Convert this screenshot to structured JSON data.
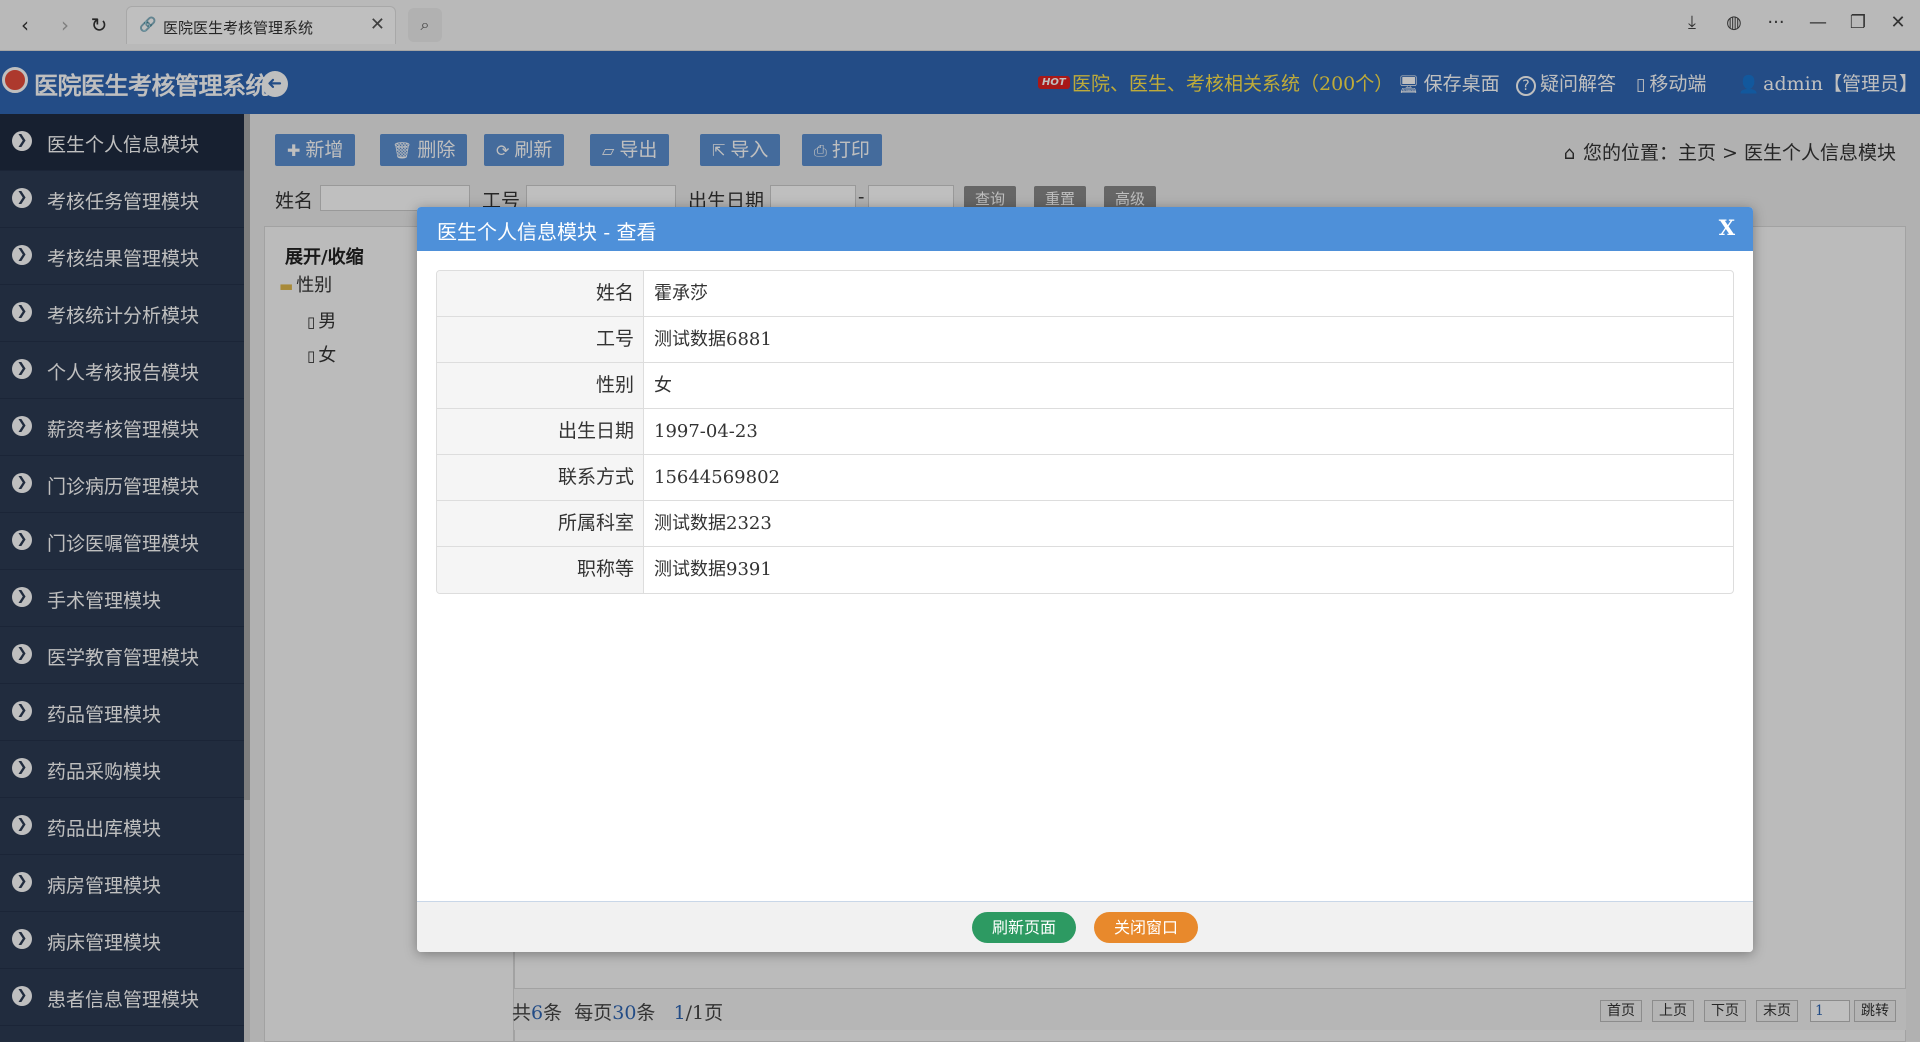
{
  "browser": {
    "tab_title": "医院医生考核管理系统",
    "tab_close": "✕",
    "back": "‹",
    "forward": "›",
    "reload": "↻",
    "search_icon": "⌕",
    "download": "⤓",
    "globe": "◍",
    "more": "···",
    "minimize": "—",
    "restore": "❐",
    "close": "✕"
  },
  "header": {
    "title": "医院医生考核管理系统",
    "hot_badge": "HOT",
    "hot_link": "医院、医生、考核相关系统（200个）",
    "save_desktop": "保存桌面",
    "faq": "疑问解答",
    "mobile": "移动端",
    "user": "admin【管理员】",
    "collapse_icon": "➜",
    "icons": {
      "save": "🖥",
      "faq": "?",
      "mobile": "▯",
      "user": "👤"
    }
  },
  "sidebar": {
    "items": [
      {
        "label": "医生个人信息模块"
      },
      {
        "label": "考核任务管理模块"
      },
      {
        "label": "考核结果管理模块"
      },
      {
        "label": "考核统计分析模块"
      },
      {
        "label": "个人考核报告模块"
      },
      {
        "label": "薪资考核管理模块"
      },
      {
        "label": "门诊病历管理模块"
      },
      {
        "label": "门诊医嘱管理模块"
      },
      {
        "label": "手术管理模块"
      },
      {
        "label": "医学教育管理模块"
      },
      {
        "label": "药品管理模块"
      },
      {
        "label": "药品采购模块"
      },
      {
        "label": "药品出库模块"
      },
      {
        "label": "病房管理模块"
      },
      {
        "label": "病床管理模块"
      },
      {
        "label": "患者信息管理模块"
      }
    ],
    "arrow": "❯"
  },
  "toolbar": {
    "add": "新增",
    "delete": "删除",
    "refresh": "刷新",
    "export": "导出",
    "import": "导入",
    "print": "打印",
    "icons": {
      "add": "✚",
      "delete": "🗑",
      "refresh": "⟳",
      "export": "▱",
      "import": "⇱",
      "print": "⎙"
    }
  },
  "breadcrumb": {
    "icon": "⌂",
    "text": "您的位置：主页 > 医生个人信息模块"
  },
  "filters": {
    "name_label": "姓名",
    "id_label": "工号",
    "birth_label": "出生日期",
    "dash": "-",
    "query": "查询",
    "reset": "重置",
    "advanced": "高级"
  },
  "tree": {
    "root": "展开/收缩",
    "gender": "性别",
    "male": "男",
    "female": "女",
    "folder_icon": "▬",
    "file_icon": "▯"
  },
  "pager": {
    "total_prefix": "共",
    "total": "6",
    "total_suffix": "条",
    "per_page_prefix": "每页",
    "per_page": "30",
    "per_page_suffix": "条",
    "page_current": "1",
    "page_sep": "/1页",
    "first": "首页",
    "prev": "上页",
    "next": "下页",
    "last": "末页",
    "page_input": "1",
    "jump": "跳转"
  },
  "modal": {
    "title": "医生个人信息模块 - 查看",
    "close": "X",
    "rows": [
      {
        "key": "姓名",
        "value": "霍承莎"
      },
      {
        "key": "工号",
        "value": "测试数据6881"
      },
      {
        "key": "性别",
        "value": "女"
      },
      {
        "key": "出生日期",
        "value": "1997-04-23"
      },
      {
        "key": "联系方式",
        "value": "15644569802"
      },
      {
        "key": "所属科室",
        "value": "测试数据2323"
      },
      {
        "key": "职称等",
        "value": "测试数据9391"
      }
    ],
    "refresh_btn": "刷新页面",
    "close_btn": "关闭窗口"
  },
  "colors": {
    "header_bg": "#2f66b3",
    "sidebar_bg": "#2d3b53",
    "modal_header": "#4e90d9",
    "refresh_btn": "#2d9a62",
    "close_btn": "#e8892c",
    "hot_link": "#ffe44d"
  }
}
